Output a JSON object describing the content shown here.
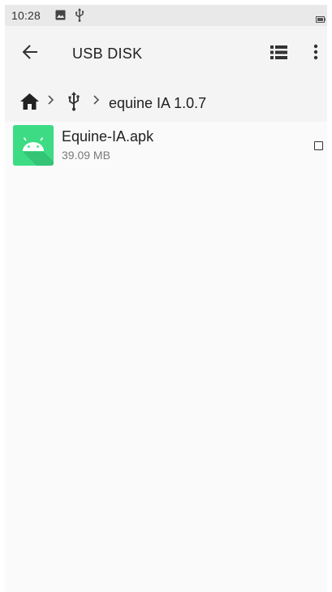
{
  "status_bar": {
    "time": "10:28",
    "icons": [
      "image-icon",
      "usb-icon",
      "battery-icon"
    ]
  },
  "app_bar": {
    "title": "USB DISK",
    "back_icon": "arrow-left-icon",
    "view_icon": "list-view-icon",
    "menu_icon": "more-vert-icon"
  },
  "breadcrumb": {
    "home_icon": "home-icon",
    "usb_icon": "usb-icon",
    "current_folder": "equine IA 1.0.7"
  },
  "files": [
    {
      "name": "Equine-IA.apk",
      "size": "39.09 MB",
      "icon": "android-apk-icon",
      "checked": false
    }
  ],
  "colors": {
    "apk_icon_bg": "#3ddc84",
    "status_bar": "#e9e9e9",
    "app_bar": "#f4f4f4"
  }
}
